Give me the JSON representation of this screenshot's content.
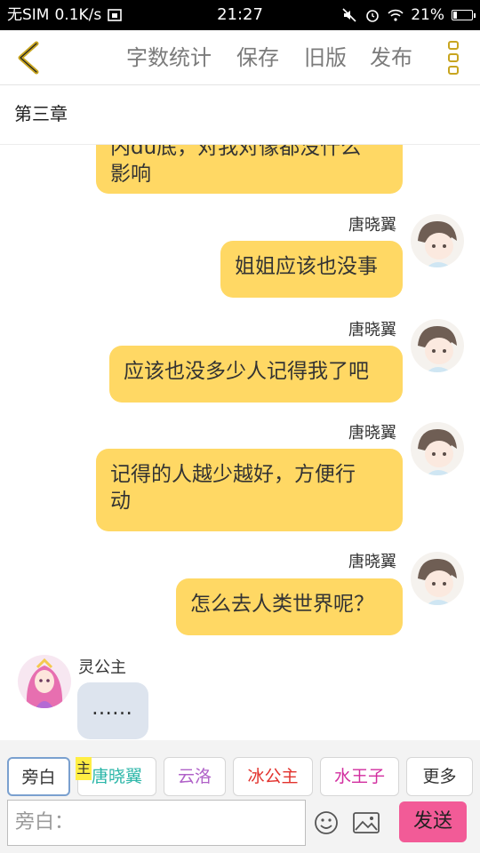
{
  "status_bar": {
    "carrier": "无SIM",
    "speed": "0.1K/s",
    "time": "21:27",
    "battery": "21%",
    "battery_level": 0.21
  },
  "toolbar": {
    "word_count": "字数统计",
    "save": "保存",
    "old_version": "旧版",
    "publish": "发布"
  },
  "chapter": {
    "title": "第三章"
  },
  "messages": [
    {
      "speaker": "",
      "text": "内du底，对我对像都没什么",
      "text2": "影响"
    },
    {
      "speaker": "唐晓翼",
      "text": "姐姐应该也没事"
    },
    {
      "speaker": "唐晓翼",
      "text": "应该也没多少人记得我了吧"
    },
    {
      "speaker": "唐晓翼",
      "text": "记得的人越少越好，方便行",
      "text2": "动"
    },
    {
      "speaker": "唐晓翼",
      "text": "怎么去人类世界呢？"
    },
    {
      "speaker": "灵公主",
      "text": "……"
    }
  ],
  "roles": {
    "narrator": "旁白",
    "host_tag": "主",
    "tang": "唐晓翼",
    "yunluo": "云洛",
    "ice": "冰公主",
    "water": "水王子",
    "more": "更多"
  },
  "colors": {
    "bubble": "#ffd864",
    "bubble_gray": "#dde4ee",
    "send": "#f25b97",
    "tang": "#2bb6a8",
    "yunluo": "#b061c8",
    "ice": "#e2322d",
    "water": "#d22d9f",
    "accent": "#c8a520"
  },
  "input": {
    "placeholder": "旁白：",
    "send": "发送"
  }
}
